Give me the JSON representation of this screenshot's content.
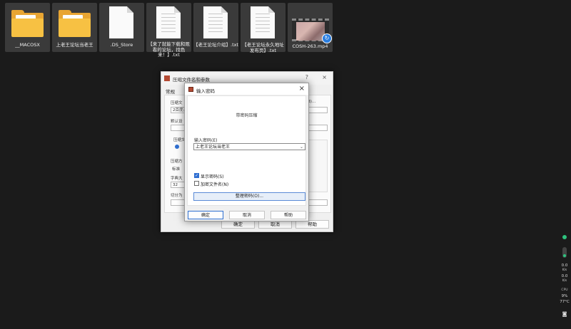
{
  "desktop": {
    "files": [
      {
        "label": "__MACOSX",
        "kind": "folder"
      },
      {
        "label": "上老王论坛当老王",
        "kind": "folder"
      },
      {
        "label": ".DS_Store",
        "kind": "blank"
      },
      {
        "label": "【来了就能下载和观看的论坛，找色来！】.txt",
        "kind": "text"
      },
      {
        "label": "【老王论坛介绍】.txt",
        "kind": "text"
      },
      {
        "label": "【老王论坛永久地址发布页】.txt",
        "kind": "text"
      },
      {
        "label": "COSH-263.mp4",
        "kind": "video"
      }
    ]
  },
  "back_window": {
    "title": "压缩文件名和参数",
    "help_btn": "?",
    "close_btn": "×",
    "tab_general": "常规",
    "archive_label": "压缩文",
    "archive_value": "2百度云",
    "browse_btn": "B)...",
    "default_label": "默认设",
    "format_label": "压缩文",
    "method_label": "压缩方",
    "method_value": "标准",
    "dict_label": "字典大",
    "dict_value": "32",
    "split_label": "切分为",
    "ok": "确定",
    "cancel": "取消",
    "help": "帮助"
  },
  "dialog": {
    "title": "输入密码",
    "subtitle": "带密码压缩",
    "password_label": "输入密码(E)",
    "password_value": "上老王论坛当老王",
    "show_password": "显示密码(S)",
    "encrypt_names": "加密文件名(N)",
    "organize_button": "整理密码(O)...",
    "ok": "确定",
    "cancel": "取消",
    "help": "帮助"
  },
  "monitor": {
    "up": "0.0",
    "up_unit": "K/s",
    "down": "0.0",
    "down_unit": "K/s",
    "cpu_label": "CPU",
    "cpu_value": "9%",
    "temp": "77°C"
  }
}
